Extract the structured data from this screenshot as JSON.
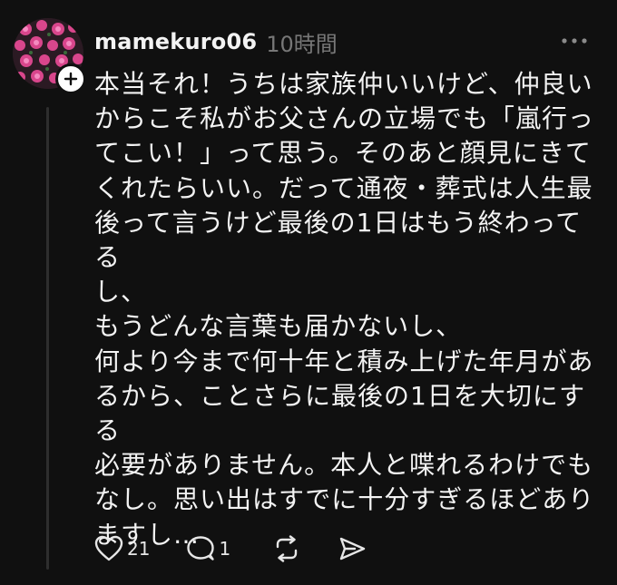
{
  "post": {
    "username": "mamekuro06",
    "timestamp": "10時間",
    "avatar_icon": "flower-avatar",
    "follow_icon": "plus-icon",
    "more_icon": "more-dots-icon",
    "body": "本当それ！うちは家族仲いいけど、仲良い\nからこそ私がお父さんの立場でも「嵐行っ\nてこい！」って思う。そのあと顔見にきて\nくれたらいい。だって通夜・葬式は人生最\n後って言うけど最後の1日はもう終わってる\nし、\nもうどんな言葉も届かないし、\n何より今まで何十年と積み上げた年月があ\nるから、ことさらに最後の1日を大切にする\n必要がありません。本人と喋れるわけでも\nなし。思い出はすでに十分すぎるほどあり\nますし…",
    "actions": {
      "like_icon": "heart-icon",
      "like_count": "21",
      "reply_icon": "comment-icon",
      "reply_count": "1",
      "repost_icon": "repost-icon",
      "share_icon": "send-icon"
    }
  },
  "colors": {
    "background": "#101010",
    "text": "#f3f3f3",
    "muted": "#777777",
    "thread_line": "#2e2e2e",
    "avatar_flower": "#e85a9c"
  }
}
